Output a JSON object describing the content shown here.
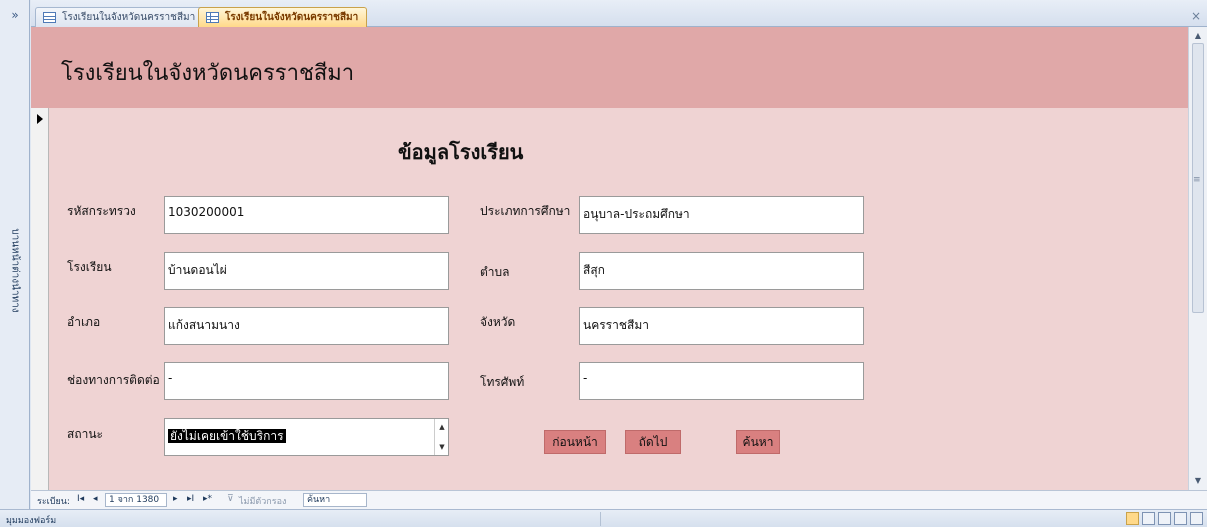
{
  "nav_pane": {
    "toggle": "»",
    "label": "บานหน้าต่างนำทาง"
  },
  "tabs": [
    {
      "label": "โรงเรียนในจังหวัดนครราชสีมา",
      "active": false,
      "icon": "table-icon"
    },
    {
      "label": "โรงเรียนในจังหวัดนครราชสีมา",
      "active": true,
      "icon": "form-icon"
    }
  ],
  "close_label": "×",
  "form": {
    "header_title": "โรงเรียนในจังหวัดนครราชสีมา",
    "section_title": "ข้อมูลโรงเรียน",
    "fields": {
      "ministry_code": {
        "label": "รหัสกระทรวง",
        "value": "1030200001"
      },
      "education_type": {
        "label": "ประเภทการศึกษา",
        "value": "อนุบาล-ประถมศึกษา"
      },
      "school": {
        "label": "โรงเรียน",
        "value": "บ้านดอนไผ่"
      },
      "subdistrict": {
        "label": "ตำบล",
        "value": "สีสุก"
      },
      "district": {
        "label": "อำเภอ",
        "value": "แก้งสนามนาง"
      },
      "province": {
        "label": "จังหวัด",
        "value": "นครราชสีมา"
      },
      "contact": {
        "label": "ช่องทางการติดต่อ",
        "value": "-"
      },
      "phone": {
        "label": "โทรศัพท์",
        "value": "-"
      },
      "status": {
        "label": "สถานะ",
        "value": "ยังไม่เคยเข้าใช้บริการ"
      }
    },
    "buttons": {
      "prev": "ก่อนหน้า",
      "next": "ถัดไป",
      "search": "ค้นหา"
    }
  },
  "record_nav": {
    "label": "ระเบียน:",
    "first": "I◂",
    "prev": "◂",
    "position": "1 จาก 1380",
    "next": "▸",
    "last": "▸I",
    "new": "▸*",
    "filter": "ไม่มีตัวกรอง",
    "search": "ค้นหา"
  },
  "status_bar": {
    "text": "มุมมองฟอร์ม"
  },
  "colors": {
    "header": "#e0a8a8",
    "detail": "#efd3d3",
    "button": "#d98080"
  }
}
